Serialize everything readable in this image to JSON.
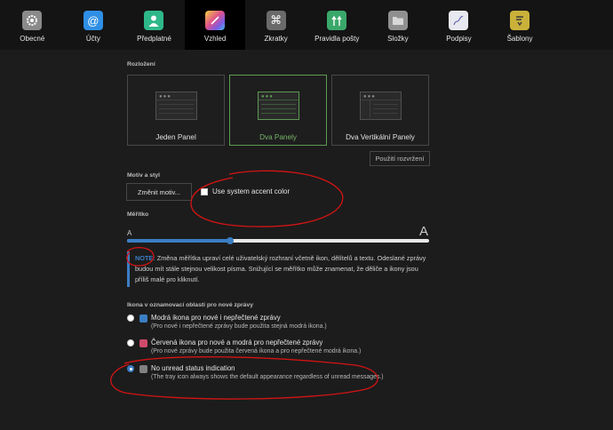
{
  "toolbar": {
    "items": [
      {
        "label": "Obecné",
        "icon": "gear-icon",
        "color": "#8a8a8a"
      },
      {
        "label": "Účty",
        "icon": "at-sign-icon",
        "color": "#2f8fe6"
      },
      {
        "label": "Předplatné",
        "icon": "person-icon",
        "color": "#2eb88a"
      },
      {
        "label": "Vzhled",
        "icon": "palette-icon",
        "color": "#e0528a"
      },
      {
        "label": "Zkratky",
        "icon": "command-icon",
        "color": "#6a6a6a"
      },
      {
        "label": "Pravidla pošty",
        "icon": "filter-arrows-icon",
        "color": "#3aa86a"
      },
      {
        "label": "Složky",
        "icon": "folder-icon",
        "color": "#909090"
      },
      {
        "label": "Podpisy",
        "icon": "signature-pen-icon",
        "color": "#c8c8d8"
      },
      {
        "label": "Šablony",
        "icon": "template-icon",
        "color": "#c9b13a"
      }
    ],
    "active_index": 3
  },
  "layout": {
    "title": "Rozložení",
    "options": [
      {
        "label": "Jeden Panel",
        "selected": false
      },
      {
        "label": "Dva Panely",
        "selected": true
      },
      {
        "label": "Dva Vertikální Panely",
        "selected": false
      }
    ],
    "use_button": "Použití rozvržení"
  },
  "theme": {
    "title": "Motiv a styl",
    "change_button": "Změnit motiv...",
    "accent_checkbox": {
      "label": "Use system accent color",
      "checked": false
    }
  },
  "scale": {
    "title": "Měřítko",
    "small_marker": "A",
    "large_marker": "A",
    "value_fraction": 0.34
  },
  "note": {
    "label": "NOTE:",
    "text": "Změna měřítka upraví celé uživatelský rozhraní včetně ikon, dělítelů a textu. Odeslané zprávy budou mít stále stejnou velikost písma. Snižující se měřítko může znamenat, že děliče a ikony jsou příliš malé pro kliknutí."
  },
  "tray": {
    "title": "Ikona v oznamovací oblasti pro nové zprávy",
    "options": [
      {
        "title": "Modrá ikona pro nové i nepřečtené zprávy",
        "desc": "(Pro nové i nepřečtené zprávy bude použita stejná modrá ikona.)",
        "icon_color": "#3b7ec4",
        "checked": false
      },
      {
        "title": "Červená ikona pro nové a modrá pro nepřečtené zprávy",
        "desc": "(Pro nové zprávy bude použita červená ikona a pro nepřečtené modrá ikona.)",
        "icon_color": "#d04a6a",
        "checked": false
      },
      {
        "title": "No unread status indication",
        "desc": "(The tray icon always shows the default appearance regardless of unread messages.)",
        "icon_color": "#808080",
        "checked": true
      }
    ]
  },
  "colors": {
    "accent": "#3b7ec4",
    "selected_green": "#5d9a52",
    "annotation_red": "#d41414"
  }
}
